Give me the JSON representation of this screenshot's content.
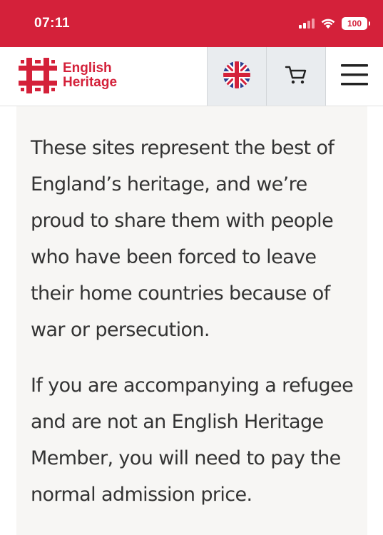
{
  "status_bar": {
    "time": "07:11",
    "battery": "100",
    "icons": [
      "signal-icon",
      "wifi-icon",
      "battery-icon"
    ]
  },
  "header": {
    "logo_line1": "English",
    "logo_line2": "Heritage",
    "language_flag": "uk-flag-icon",
    "cart_icon": "cart-icon",
    "menu_icon": "menu-icon"
  },
  "content": {
    "paragraphs": [
      "These sites represent the best of England’s heritage, and we’re proud to share them with people who have been forced to leave their home countries because of war or persecution.",
      "If you are accompanying a refugee and are not an English Heritage Member, you will need to pay the normal admission price."
    ]
  },
  "colors": {
    "brand_red": "#d4213a",
    "panel_bg": "#f7f6f4",
    "button_bg": "#e9ecef",
    "text": "#333333"
  }
}
